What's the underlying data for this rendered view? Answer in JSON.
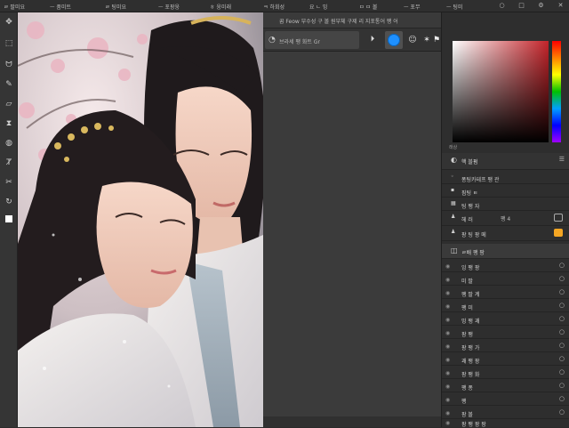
{
  "menubar": {
    "items": [
      "ㄹ 팔미요",
      "ㅡ 품미트",
      "ㄹ 팅미요",
      "ㅡ 포팡웅",
      "ㅎ 웅미래",
      "ㅋ 하회성",
      "요 ㄴ 밍",
      "ㅁ ㅁ 볼",
      "ㅡ 포무",
      "ㅡ 팅미"
    ],
    "win_icons": [
      "○",
      "□",
      "⚙",
      "✕"
    ]
  },
  "options": {
    "title": "꿉 Feow 부수성 구 볼 원부체 구제 리 지포통어 팽 어"
  },
  "brushbar": {
    "preset_label": "브라세 팽 화트 Gr"
  },
  "color_panel": {
    "label": "래상"
  },
  "properties": {
    "header": "핵 블펌",
    "rows": [
      "퐁팅카테프 팽 관",
      "핌팅 ㅌ",
      "팅 팽 자",
      "헤 러",
      "팡 팅 팡 메"
    ],
    "badge": "팽 4"
  },
  "layers": {
    "header": "ㄹ배 팽 팡",
    "items": [
      "잉 팽 팡",
      "미 팔",
      "팽 팔 계",
      "팽 미",
      "밍 팽 괘",
      "팡 팽",
      "팡 팽 가",
      "괘 팽 팡",
      "팡 팽 화",
      "팽 퐁",
      "팽",
      "팡 볼",
      "팡 팽 팡 팡"
    ]
  },
  "colors": {
    "accent": "#1e90ff",
    "badge": "#f5a623",
    "panel": "#2e2e2e"
  }
}
